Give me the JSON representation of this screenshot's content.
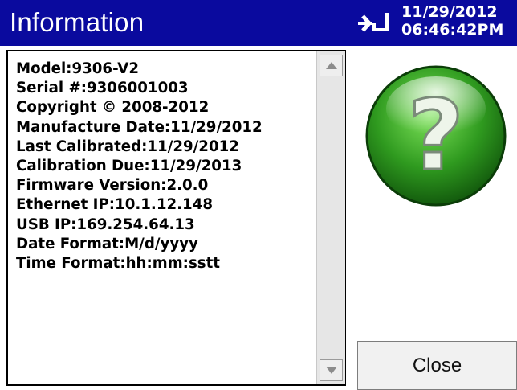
{
  "window": {
    "title": "Information"
  },
  "status": {
    "connection_icon": "usb-connect-icon",
    "date": "11/29/2012",
    "time": "06:46:42PM"
  },
  "info": {
    "lines": [
      "Model:9306-V2",
      "Serial #:9306001003",
      "Copyright © 2008-2012",
      "Manufacture Date:11/29/2012",
      "Last Calibrated:11/29/2012",
      "Calibration Due:11/29/2013",
      "Firmware Version:2.0.0",
      "Ethernet IP:10.1.12.148",
      "USB IP:169.254.64.13",
      "Date Format:M/d/yyyy",
      "Time Format:hh:mm:sstt"
    ]
  },
  "help": {
    "icon": "question-icon",
    "glyph": "?"
  },
  "buttons": {
    "close_label": "Close"
  },
  "colors": {
    "titlebar": "#0a0a9e",
    "accent_green": "#2f9a1f"
  }
}
